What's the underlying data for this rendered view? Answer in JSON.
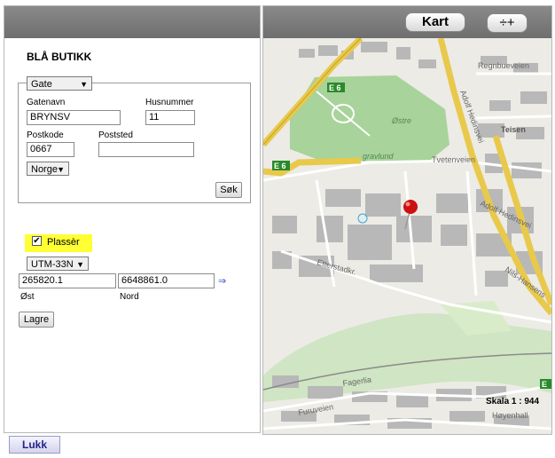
{
  "store": {
    "title": "BLÅ BUTIKK"
  },
  "address": {
    "search_type": "Gate",
    "street_label": "Gatenavn",
    "street_value": "BRYNSV",
    "number_label": "Husnummer",
    "number_value": "11",
    "postcode_label": "Postkode",
    "postcode_value": "0667",
    "place_label": "Poststed",
    "place_value": "",
    "country": "Norge",
    "search_button": "Søk"
  },
  "placement": {
    "checkbox_label": "Plassèr",
    "checked": true,
    "projection": "UTM-33N",
    "east_value": "265820.1",
    "north_value": "6648861.0",
    "east_label": "Øst",
    "north_label": "Nord",
    "save_button": "Lagre",
    "arrow": "⇒"
  },
  "map": {
    "kart_button": "Kart",
    "zoom_glyph": "÷+",
    "scale_text": "Skala 1 : 944",
    "labels": {
      "e6_top": "E 6",
      "e6_left": "E 6",
      "e_right": "E",
      "ostre": "Østre",
      "gravlund": "gravlund",
      "regnbueveien": "Regnbueveien",
      "teisen": "Teisen",
      "tvetenveien": "Tvetenveien",
      "adolf1": "Adolf Hedinsvei",
      "adolf2": "Adolf Hedinsvei",
      "etterstadkr": "Etterstadkr.",
      "nils": "Nils-Hansens",
      "fagerlia": "Fagerlia",
      "furuveien": "Furuveien",
      "hoyenhall": "Høyenhall"
    }
  },
  "footer": {
    "close_button": "Lukk"
  }
}
